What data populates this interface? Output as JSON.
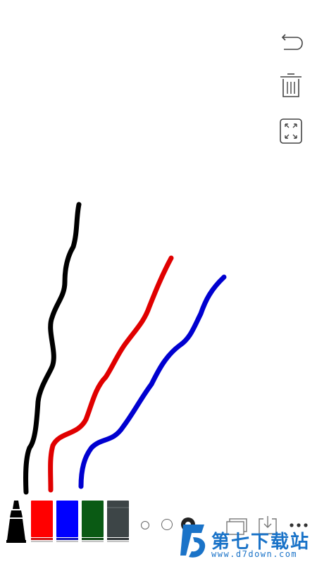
{
  "tools": {
    "undo_icon": "undo-icon",
    "delete_icon": "trash-icon",
    "fullscreen_icon": "expand-icon"
  },
  "palette": {
    "pen_color": "#000000",
    "swatches": [
      {
        "name": "red",
        "color": "#ff0000"
      },
      {
        "name": "blue",
        "color": "#0000ff"
      },
      {
        "name": "green",
        "color": "#0a5a14"
      },
      {
        "name": "gray",
        "color": "#3d4547"
      }
    ]
  },
  "brush_sizes": [
    "small",
    "medium",
    "large"
  ],
  "selected_brush_size": "large",
  "actions": {
    "layers_icon": "layers-icon",
    "save_icon": "save-icon",
    "more_icon": "more-icon"
  },
  "strokes": [
    {
      "color": "#000000"
    },
    {
      "color": "#e00000"
    },
    {
      "color": "#0000d0"
    }
  ],
  "watermark": {
    "brand": "第七下载站",
    "url": "www.d7down.com"
  }
}
